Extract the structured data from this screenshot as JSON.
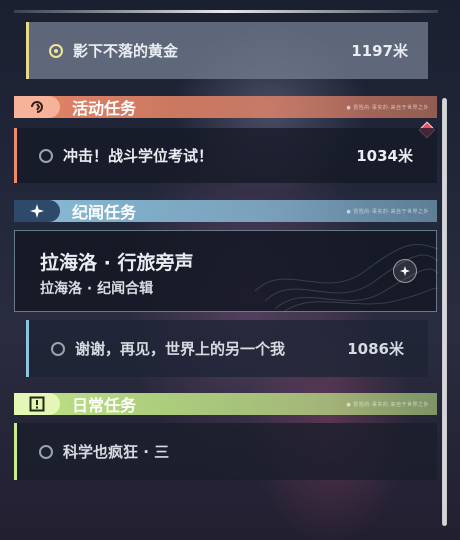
{
  "tracked_quest": {
    "name": "影下不落的黄金",
    "distance": "1197米"
  },
  "sections": {
    "event": {
      "title": "活动任务",
      "tag": "● 冒险的·事实的·来自于世界之外",
      "color": "#f08a6a"
    },
    "world": {
      "title": "纪闻任务",
      "tag": "● 冒险的·事实的·来自于世界之外",
      "color": "#8fc4e0"
    },
    "daily": {
      "title": "日常任务",
      "tag": "● 冒险的·事实的·来自于世界之外",
      "color": "#c7ee8a"
    }
  },
  "event_quest": {
    "name": "冲击！战斗学位考试！",
    "distance": "1034米"
  },
  "world_card": {
    "title": "拉海洛 · 行旅旁声",
    "subtitle": "拉海洛 · 纪闻合辑"
  },
  "world_quest": {
    "name": "谢谢，再见，世界上的另一个我",
    "distance": "1086米"
  },
  "daily_quest": {
    "name": "科学也疯狂 · 三",
    "distance": ""
  },
  "icons": {
    "event": "event-swirl-icon",
    "world": "sparkle-star-icon",
    "daily": "exclamation-box-icon",
    "alert": "red-diamond-alert-icon",
    "world_card": "star-emblem-icon"
  }
}
